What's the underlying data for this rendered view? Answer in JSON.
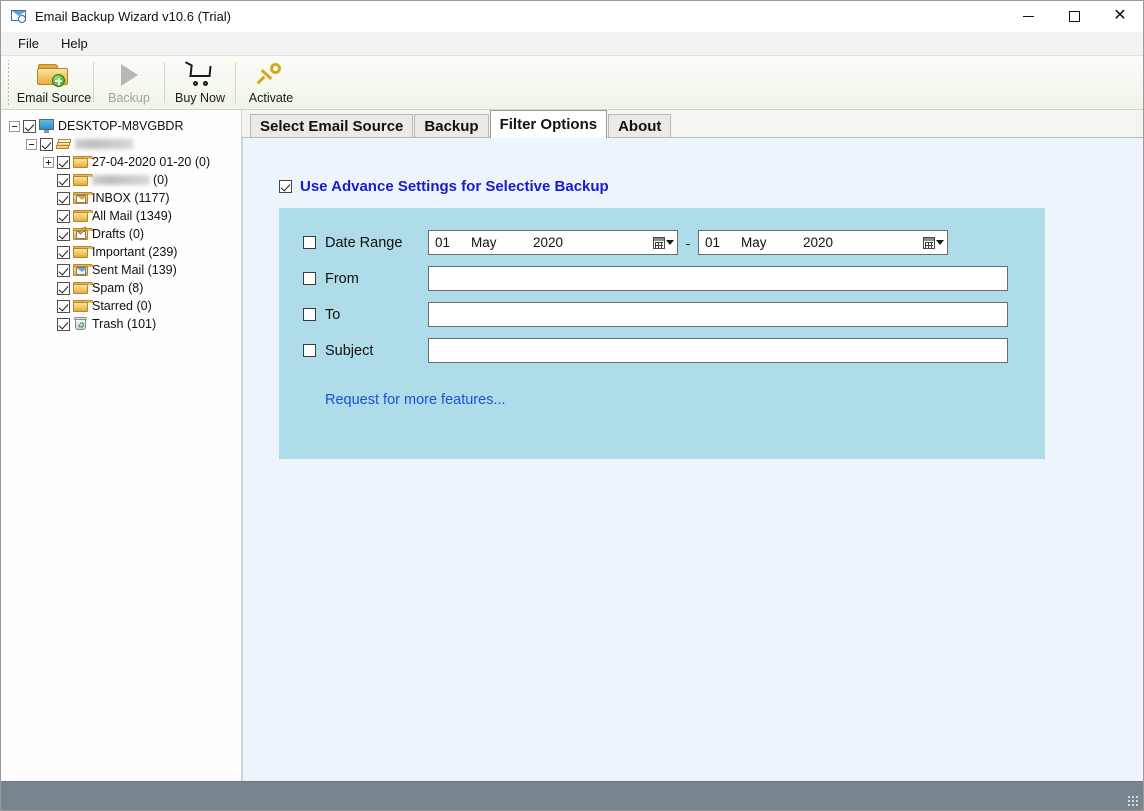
{
  "window": {
    "title": "Email Backup Wizard v10.6 (Trial)",
    "app_icon": "envelope-clock-icon",
    "controls": {
      "minimize": "minimize-icon",
      "maximize": "maximize-icon",
      "close": "close-icon"
    }
  },
  "menu": {
    "items": [
      "File",
      "Help"
    ]
  },
  "toolbar": {
    "buttons": [
      {
        "label": "Email Source",
        "icon": "folder-add-icon",
        "enabled": true
      },
      {
        "label": "Backup",
        "icon": "play-icon",
        "enabled": false
      },
      {
        "label": "Buy Now",
        "icon": "shopping-cart-icon",
        "enabled": true
      },
      {
        "label": "Activate",
        "icon": "key-icon",
        "enabled": true
      }
    ]
  },
  "tree": {
    "root": {
      "label": "DESKTOP-M8VGBDR",
      "icon": "monitor-icon",
      "checked": true,
      "expanded": true
    },
    "account": {
      "label": "",
      "redacted": true,
      "icon": "folder-stack-icon",
      "checked": true,
      "expanded": true
    },
    "folders": [
      {
        "label": "27-04-2020 01-20 (0)",
        "icon": "folder-icon",
        "checked": true,
        "expandable": true,
        "redacted": false
      },
      {
        "label": "",
        "count": "(0)",
        "icon": "folder-icon",
        "checked": true,
        "expandable": false,
        "redacted": true
      },
      {
        "label": "INBOX (1177)",
        "icon": "folder-inbox-icon",
        "checked": true,
        "expandable": false,
        "redacted": false
      },
      {
        "label": "All Mail (1349)",
        "icon": "folder-icon",
        "checked": true,
        "expandable": false,
        "redacted": false
      },
      {
        "label": "Drafts (0)",
        "icon": "folder-draft-icon",
        "checked": true,
        "expandable": false,
        "redacted": false
      },
      {
        "label": "Important (239)",
        "icon": "folder-icon",
        "checked": true,
        "expandable": false,
        "redacted": false
      },
      {
        "label": "Sent Mail (139)",
        "icon": "folder-sent-icon",
        "checked": true,
        "expandable": false,
        "redacted": false
      },
      {
        "label": "Spam (8)",
        "icon": "folder-icon",
        "checked": true,
        "expandable": false,
        "redacted": false
      },
      {
        "label": "Starred (0)",
        "icon": "folder-icon",
        "checked": true,
        "expandable": false,
        "redacted": false
      },
      {
        "label": "Trash (101)",
        "icon": "trash-icon",
        "checked": true,
        "expandable": false,
        "redacted": false
      }
    ]
  },
  "tabs": [
    {
      "label": "Select Email Source",
      "active": false
    },
    {
      "label": "Backup",
      "active": false
    },
    {
      "label": "Filter Options",
      "active": true
    },
    {
      "label": "About",
      "active": false
    }
  ],
  "filter_panel": {
    "advance_settings": {
      "label": "Use Advance Settings for Selective Backup",
      "checked": true,
      "color": "#1a1ad0"
    },
    "panel_color": "#aedce8",
    "date_range": {
      "label": "Date Range",
      "checked": false,
      "separator": "-",
      "from": {
        "day": "01",
        "month": "May",
        "year": "2020"
      },
      "to": {
        "day": "01",
        "month": "May",
        "year": "2020"
      },
      "calendar_icon": "calendar-icon",
      "dropdown_icon": "chevron-down-icon"
    },
    "from": {
      "label": "From",
      "checked": false,
      "value": "",
      "placeholder": ""
    },
    "to": {
      "label": "To",
      "checked": false,
      "value": "",
      "placeholder": ""
    },
    "subject": {
      "label": "Subject",
      "checked": false,
      "value": "",
      "placeholder": ""
    },
    "request_link": "Request for more features..."
  },
  "statusbar": {
    "text": "",
    "grip": "resize-grip-icon",
    "color": "#78848f"
  }
}
